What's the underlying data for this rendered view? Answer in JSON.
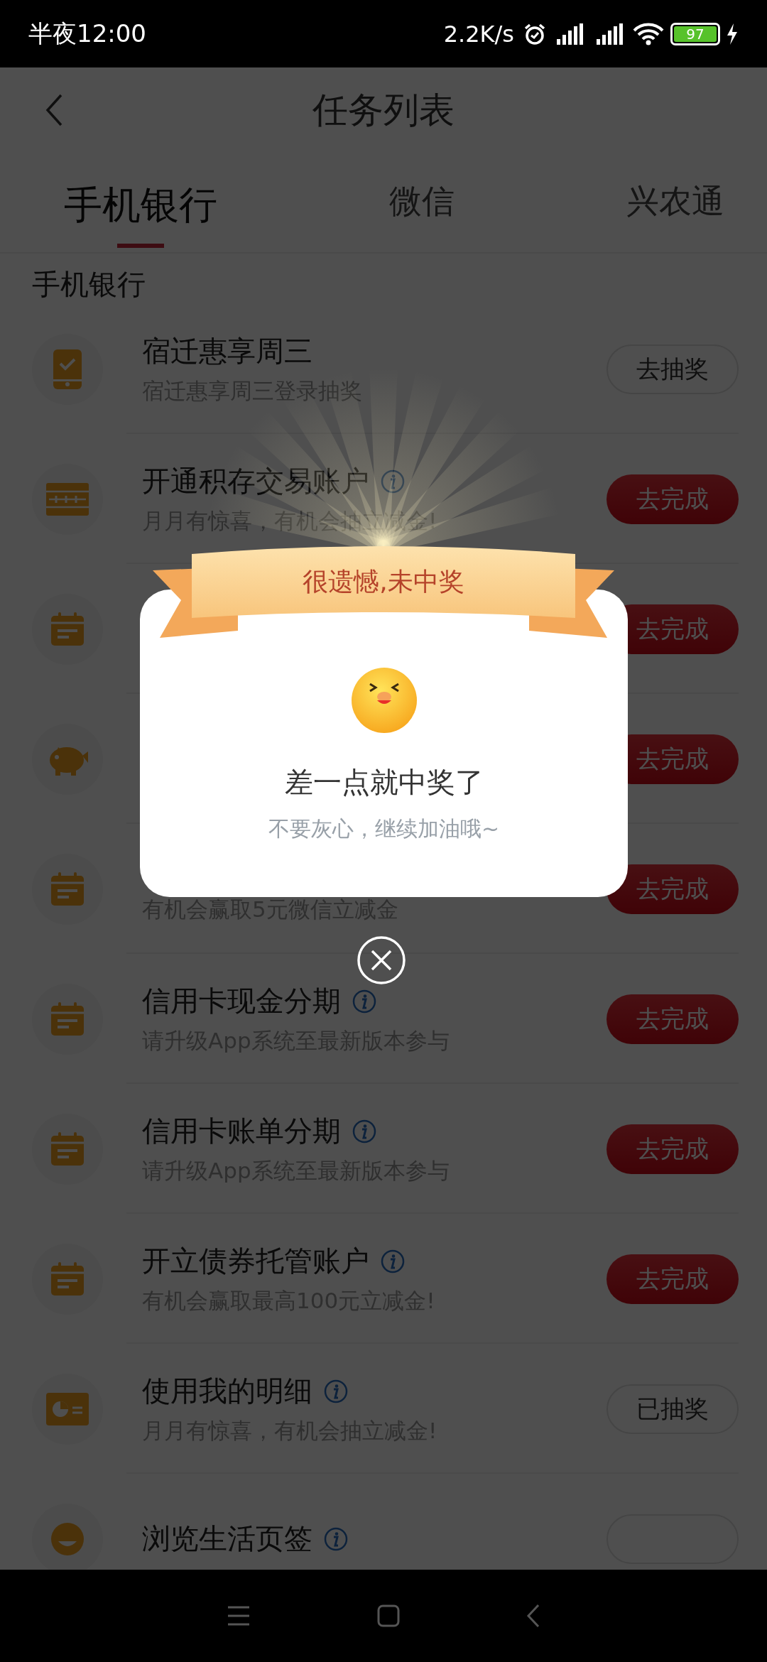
{
  "status_bar": {
    "time": "半夜12:00",
    "speed": "2.2K/s",
    "battery": "97"
  },
  "header": {
    "title": "任务列表"
  },
  "tabs": [
    {
      "label": "手机银行",
      "selected": true
    },
    {
      "label": "微信",
      "selected": false
    },
    {
      "label": "兴农通",
      "selected": false
    }
  ],
  "section_title": "手机银行",
  "tasks": [
    {
      "kind": "phone",
      "title": "宿迁惠享周三",
      "subtitle": "宿迁惠享周三登录抽奖",
      "info": false,
      "button": {
        "label": "去抽奖",
        "kind": "outline"
      }
    },
    {
      "kind": "abacus",
      "title": "开通积存交易账户",
      "subtitle": "月月有惊喜，有机会抽立减金!",
      "info": true,
      "button": {
        "label": "去完成",
        "kind": "primary"
      }
    },
    {
      "kind": "calendar",
      "info": false,
      "button": {
        "label": "去完成",
        "kind": "primary"
      }
    },
    {
      "kind": "piggy",
      "info": false,
      "button": {
        "label": "去完成",
        "kind": "primary"
      }
    },
    {
      "kind": "calendar",
      "subtitle": "有机会赢取5元微信立减金",
      "info": false,
      "button": {
        "label": "去完成",
        "kind": "primary"
      }
    },
    {
      "kind": "calendar",
      "title": "信用卡现金分期",
      "subtitle": "请升级App系统至最新版本参与",
      "info": true,
      "button": {
        "label": "去完成",
        "kind": "primary"
      }
    },
    {
      "kind": "calendar",
      "title": "信用卡账单分期",
      "subtitle": "请升级App系统至最新版本参与",
      "info": true,
      "button": {
        "label": "去完成",
        "kind": "primary"
      }
    },
    {
      "kind": "calendar",
      "title": "开立债券托管账户",
      "subtitle": "有机会赢取最高100元立减金!",
      "info": true,
      "button": {
        "label": "去完成",
        "kind": "primary"
      }
    },
    {
      "kind": "chart",
      "title": "使用我的明细",
      "subtitle": "月月有惊喜，有机会抽立减金!",
      "info": true,
      "button": {
        "label": "已抽奖",
        "kind": "outline"
      }
    },
    {
      "kind": "face",
      "title": "浏览生活页签",
      "info": true,
      "button": {
        "kind": "outline"
      }
    }
  ],
  "dialog": {
    "banner": "很遗憾,未中奖",
    "title": "差一点就中奖了",
    "message": "不要灰心，继续加油哦~"
  }
}
